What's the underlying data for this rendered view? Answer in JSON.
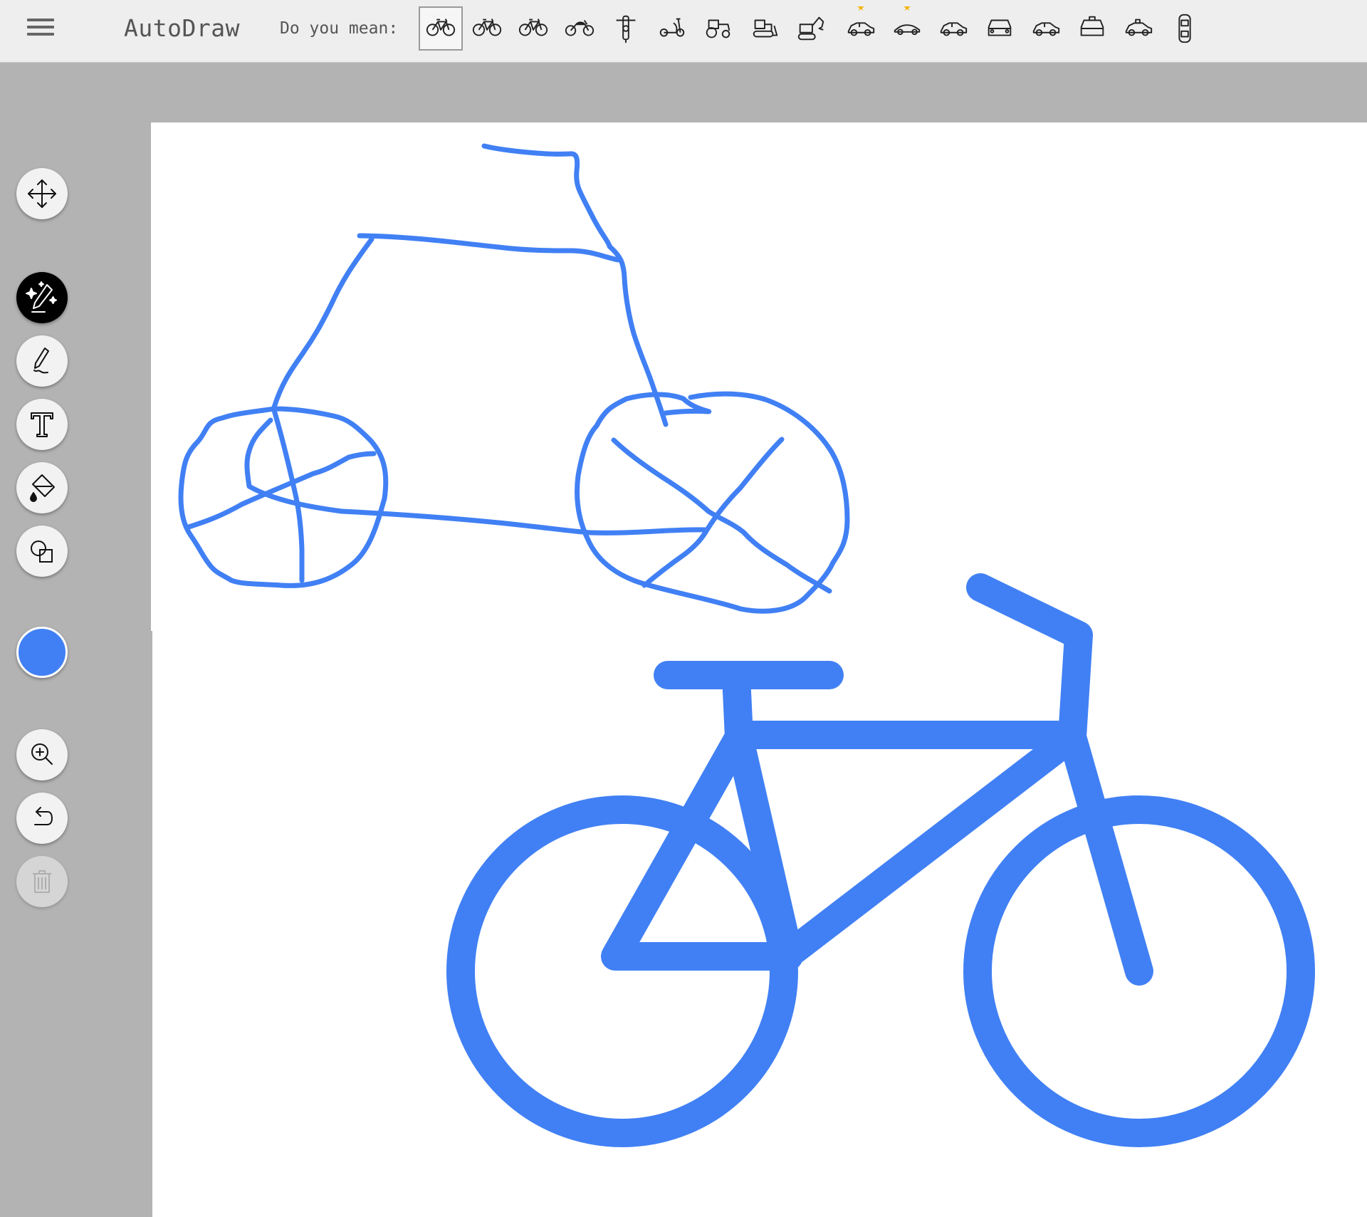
{
  "app": {
    "title": "AutoDraw"
  },
  "toolbar": {
    "suggest_label": "Do you mean:",
    "suggestions": [
      {
        "icon": "bicycle-icon",
        "selected": true,
        "starred": false
      },
      {
        "icon": "bicycle-icon",
        "selected": false,
        "starred": false
      },
      {
        "icon": "bicycle-icon",
        "selected": false,
        "starred": false
      },
      {
        "icon": "motorcycle-icon",
        "selected": false,
        "starred": false
      },
      {
        "icon": "motorcycle-front-icon",
        "selected": false,
        "starred": false
      },
      {
        "icon": "scooter-icon",
        "selected": false,
        "starred": false
      },
      {
        "icon": "tractor-icon",
        "selected": false,
        "starred": false
      },
      {
        "icon": "bulldozer-icon",
        "selected": false,
        "starred": false
      },
      {
        "icon": "excavator-icon",
        "selected": false,
        "starred": false
      },
      {
        "icon": "car-icon",
        "selected": false,
        "starred": true
      },
      {
        "icon": "car-outline-icon",
        "selected": false,
        "starred": true
      },
      {
        "icon": "car-icon",
        "selected": false,
        "starred": false
      },
      {
        "icon": "car-front-icon",
        "selected": false,
        "starred": false
      },
      {
        "icon": "car-icon",
        "selected": false,
        "starred": false
      },
      {
        "icon": "police-car-icon",
        "selected": false,
        "starred": false
      },
      {
        "icon": "police-car-side-icon",
        "selected": false,
        "starred": false
      },
      {
        "icon": "car-top-icon",
        "selected": false,
        "starred": false
      }
    ]
  },
  "tools": [
    {
      "name": "move-tool",
      "icon": "move-icon",
      "active": false
    },
    {
      "name": "autodraw-tool",
      "icon": "autodraw-sparkle-pencil-icon",
      "active": true
    },
    {
      "name": "draw-tool",
      "icon": "pencil-icon",
      "active": false
    },
    {
      "name": "type-tool",
      "icon": "text-icon",
      "active": false
    },
    {
      "name": "fill-tool",
      "icon": "paint-bucket-icon",
      "active": false
    },
    {
      "name": "shape-tool",
      "icon": "shapes-icon",
      "active": false
    },
    {
      "name": "zoom-tool",
      "icon": "zoom-in-icon",
      "active": false
    },
    {
      "name": "undo-tool",
      "icon": "undo-icon",
      "active": false
    },
    {
      "name": "delete-tool",
      "icon": "trash-icon",
      "active": false,
      "disabled": true
    }
  ],
  "colors": {
    "current": "#4180f4",
    "top_bar": "#eeeeee",
    "frame": "#b3b3b3",
    "star": "#f4b400"
  }
}
